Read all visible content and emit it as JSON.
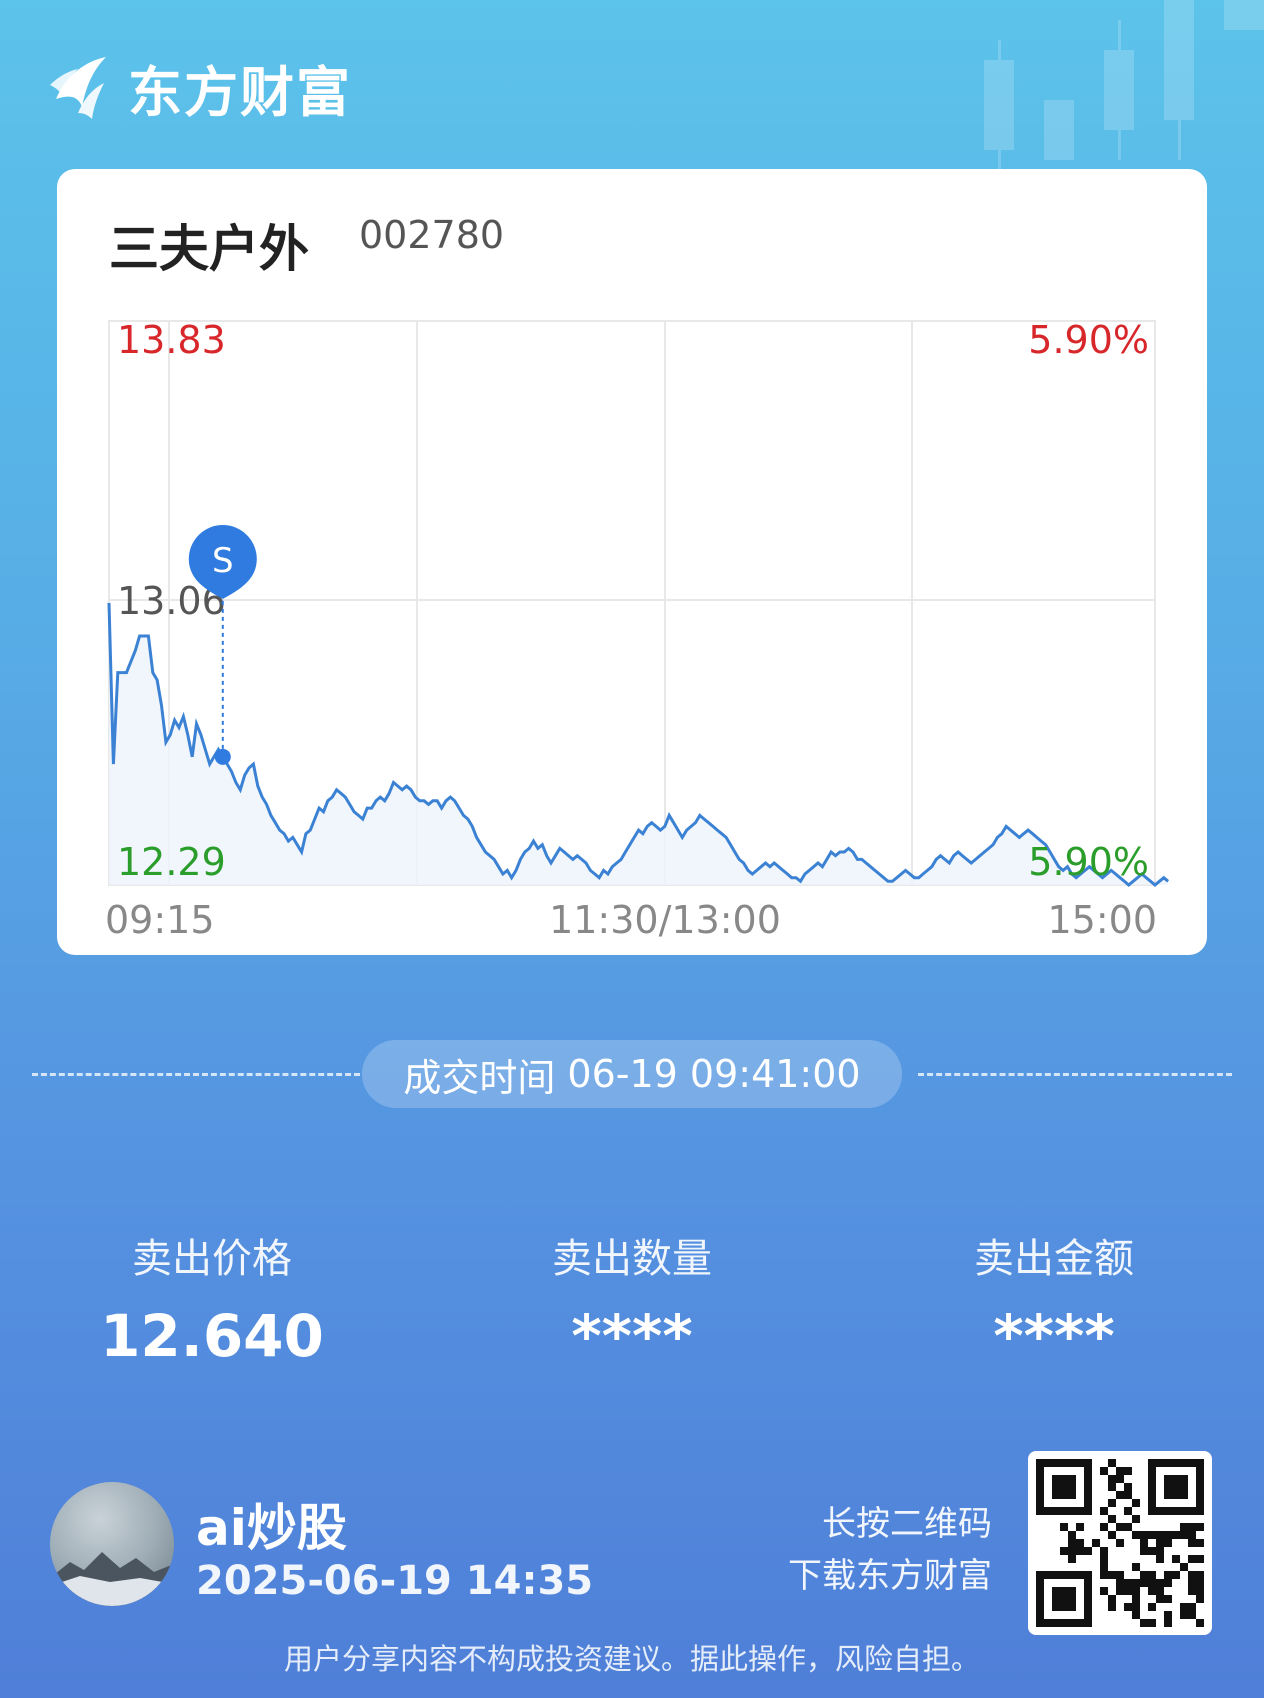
{
  "brand": {
    "name": "东方财富",
    "logo_icon": "eastmoney-logo-icon"
  },
  "stock": {
    "name": "三夫户外",
    "code": "002780"
  },
  "chart_data": {
    "type": "line",
    "y_high": "13.83",
    "y_mid": "13.06",
    "y_low": "12.29",
    "pct_high": "5.90%",
    "pct_low": "5.90%",
    "x_ticks": [
      "09:15",
      "11:30/13:00",
      "15:00"
    ],
    "ylim": [
      12.29,
      13.83
    ],
    "sell_marker": {
      "label": "S",
      "x_index": 26,
      "price": 12.64
    },
    "x_count": 240,
    "values": [
      13.06,
      12.62,
      12.87,
      12.87,
      12.87,
      12.9,
      12.93,
      12.97,
      12.97,
      12.97,
      12.87,
      12.85,
      12.78,
      12.68,
      12.7,
      12.74,
      12.72,
      12.75,
      12.7,
      12.64,
      12.73,
      12.7,
      12.66,
      12.62,
      12.64,
      12.66,
      12.64,
      12.62,
      12.6,
      12.57,
      12.55,
      12.59,
      12.61,
      12.62,
      12.56,
      12.53,
      12.51,
      12.48,
      12.46,
      12.44,
      12.43,
      12.41,
      12.42,
      12.4,
      12.38,
      12.43,
      12.44,
      12.47,
      12.5,
      12.49,
      12.52,
      12.53,
      12.55,
      12.54,
      12.53,
      12.51,
      12.49,
      12.48,
      12.47,
      12.5,
      12.5,
      12.52,
      12.53,
      12.52,
      12.54,
      12.57,
      12.56,
      12.55,
      12.56,
      12.55,
      12.53,
      12.52,
      12.52,
      12.51,
      12.52,
      12.52,
      12.5,
      12.52,
      12.53,
      12.52,
      12.5,
      12.48,
      12.47,
      12.45,
      12.42,
      12.4,
      12.38,
      12.37,
      12.36,
      12.34,
      12.32,
      12.33,
      12.31,
      12.33,
      12.36,
      12.38,
      12.39,
      12.41,
      12.39,
      12.4,
      12.37,
      12.35,
      12.37,
      12.39,
      12.38,
      12.37,
      12.36,
      12.37,
      12.36,
      12.35,
      12.33,
      12.32,
      12.31,
      12.33,
      12.32,
      12.34,
      12.35,
      12.36,
      12.38,
      12.4,
      12.42,
      12.44,
      12.43,
      12.45,
      12.46,
      12.45,
      12.44,
      12.45,
      12.48,
      12.46,
      12.44,
      12.42,
      12.44,
      12.45,
      12.46,
      12.48,
      12.47,
      12.46,
      12.45,
      12.44,
      12.43,
      12.42,
      12.4,
      12.38,
      12.36,
      12.35,
      12.33,
      12.32,
      12.33,
      12.34,
      12.35,
      12.34,
      12.35,
      12.34,
      12.33,
      12.32,
      12.31,
      12.31,
      12.3,
      12.32,
      12.33,
      12.34,
      12.35,
      12.34,
      12.36,
      12.38,
      12.37,
      12.38,
      12.38,
      12.39,
      12.38,
      12.36,
      12.36,
      12.35,
      12.34,
      12.33,
      12.32,
      12.31,
      12.3,
      12.3,
      12.31,
      12.32,
      12.33,
      12.32,
      12.31,
      12.31,
      12.32,
      12.33,
      12.34,
      12.36,
      12.37,
      12.36,
      12.35,
      12.37,
      12.38,
      12.37,
      12.36,
      12.35,
      12.36,
      12.37,
      12.38,
      12.39,
      12.4,
      12.42,
      12.43,
      12.45,
      12.44,
      12.43,
      12.42,
      12.43,
      12.44,
      12.43,
      12.42,
      12.41,
      12.4,
      12.38,
      12.36,
      12.34,
      12.33,
      12.34,
      12.32,
      12.31,
      12.32,
      12.33,
      12.34,
      12.33,
      12.32,
      12.31,
      12.32,
      12.33,
      12.32,
      12.31,
      12.3,
      12.29,
      12.3,
      12.31,
      12.32,
      12.31,
      12.3,
      12.29,
      12.3,
      12.31,
      12.3
    ]
  },
  "trade": {
    "label": "成交时间",
    "datetime": "06-19 09:41:00"
  },
  "stats": [
    {
      "label": "卖出价格",
      "value": "12.640"
    },
    {
      "label": "卖出数量",
      "value": "****"
    },
    {
      "label": "卖出金额",
      "value": "****"
    }
  ],
  "user": {
    "name": "ai炒股",
    "time": "2025-06-19 14:35"
  },
  "qr": {
    "line1": "长按二维码",
    "line2": "下载东方财富"
  },
  "disclaimer": "用户分享内容不构成投资建议。据此操作，风险自担。",
  "colors": {
    "up": "#d8272b",
    "down": "#2a9d2a",
    "line": "#3b82d4",
    "marker": "#2f7be0"
  }
}
